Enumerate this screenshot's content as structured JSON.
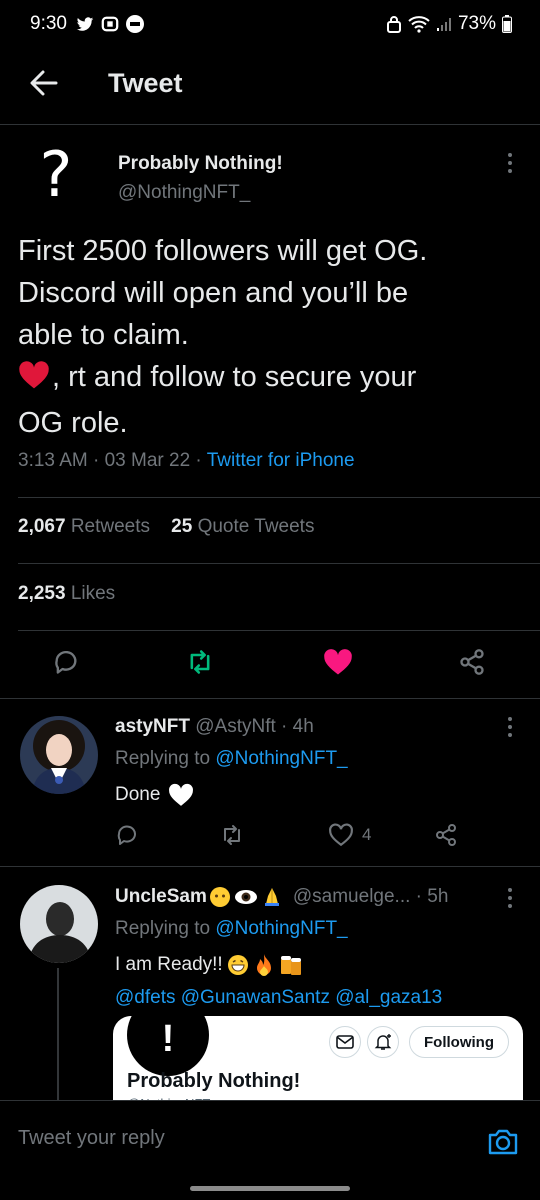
{
  "status_bar": {
    "time": "9:30",
    "battery": "73%"
  },
  "header": {
    "title": "Tweet"
  },
  "tweet": {
    "author_avatar_glyph": "?",
    "author_name": "Probably Nothing!",
    "author_handle": "@NothingNFT_",
    "lines": [
      "First 2500 followers will get OG.",
      "Discord will open and you’ll be",
      "able to claim."
    ],
    "line4_suffix": ", rt and follow to secure your",
    "line5": "OG role.",
    "timestamp": "3:13 AM · 03 Mar 22 · ",
    "source": "Twitter for iPhone",
    "retweets_count": "2,067",
    "retweets_label": "Retweets",
    "quotes_count": "25",
    "quotes_label": "Quote Tweets",
    "likes_count": "2,253",
    "likes_label": "Likes",
    "accent": "#1d9bf0",
    "retweet_color": "#00ba7c",
    "like_color": "#f91880"
  },
  "replies": [
    {
      "name": "astyNFT",
      "handle_time": "@AstyNft · 4h",
      "replying_to_prefix": "Replying to ",
      "replying_to": "@NothingNFT_",
      "text": "Done",
      "likes": "4"
    },
    {
      "name": "UncleSam",
      "handle_time": "@samuelge... · 5h",
      "replying_to_prefix": "Replying to ",
      "replying_to": "@NothingNFT_",
      "text": "I am Ready!!",
      "mentions": "@dfets @GunawanSantz @al_gaza13",
      "card": {
        "avatar_glyph": "!",
        "follow_label": "Following",
        "name": "Probably Nothing!",
        "handle": "@NothingNFT_"
      }
    }
  ],
  "reply_bar": {
    "placeholder": "Tweet your reply"
  }
}
